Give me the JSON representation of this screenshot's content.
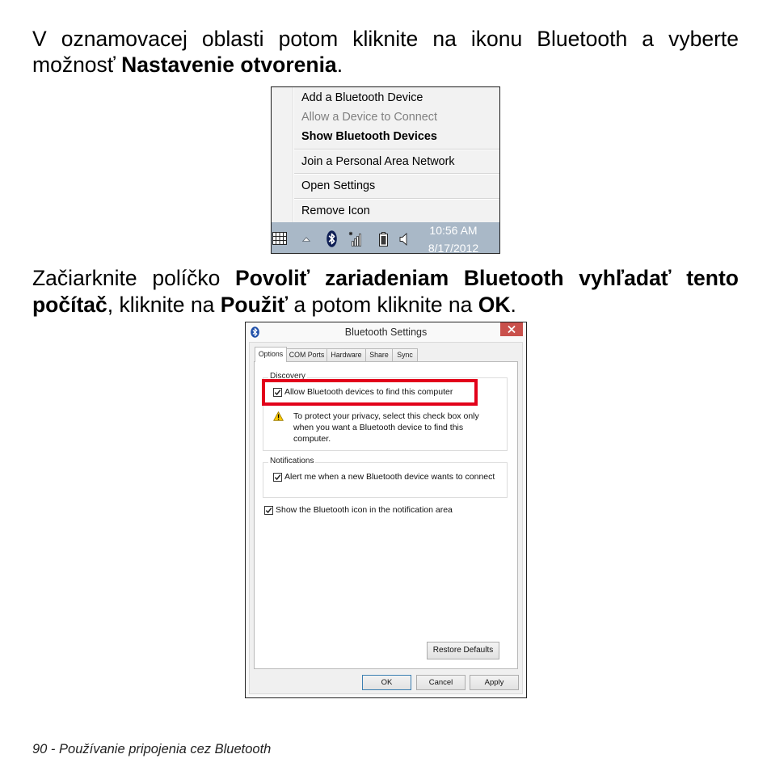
{
  "step1": {
    "line1": "V oznamovacej oblasti potom kliknite na ikonu Bluetooth a vyberte",
    "line2_text": "možnosť ",
    "line2_bold": "Nastavenie otvorenia",
    "line2_end": "."
  },
  "step2": {
    "line1_text": "Začiarknite políčko ",
    "line1_bold": "Povoliť zariadeniam Bluetooth vyhľadať tento",
    "line2_bold_a": "počítač",
    "line2_text_a": ", kliknite na ",
    "line2_bold_b": "Použiť",
    "line2_text_b": " a potom kliknite na ",
    "line2_bold_c": "OK",
    "line2_end": "."
  },
  "context_menu": {
    "items": [
      {
        "label": "Add a Bluetooth Device"
      },
      {
        "label": "Allow a Device to Connect",
        "disabled": true
      },
      {
        "label": "Show Bluetooth Devices",
        "bold": true
      },
      {
        "label": "Join a Personal Area Network"
      },
      {
        "label": "Open Settings"
      },
      {
        "label": "Remove Icon"
      }
    ]
  },
  "taskbar": {
    "tray_icons": [
      "keyboard-icon",
      "show-hidden-icons-icon",
      "bluetooth-icon",
      "network-signal-icon",
      "battery-icon",
      "speaker-icon"
    ],
    "time": "10:56 AM",
    "date": "8/17/2012"
  },
  "dialog": {
    "title": "Bluetooth Settings",
    "tabs": [
      {
        "label": "Options",
        "active": true
      },
      {
        "label": "COM Ports"
      },
      {
        "label": "Hardware"
      },
      {
        "label": "Share"
      },
      {
        "label": "Sync"
      }
    ],
    "discovery": {
      "group_label": "Discovery",
      "allow_label": "Allow Bluetooth devices to find this computer",
      "allow_checked": true,
      "warning_icon": "warning-icon",
      "warning_lines": [
        "To protect your privacy, select this check box only",
        "when you want a Bluetooth device to find this",
        "computer."
      ]
    },
    "notifications": {
      "group_label": "Notifications",
      "alert_label": "Alert me when a new Bluetooth device wants to connect",
      "alert_checked": true
    },
    "show_icon_label": "Show the Bluetooth icon in the notification area",
    "show_icon_checked": true,
    "restore_defaults": "Restore Defaults",
    "ok": "OK",
    "cancel": "Cancel",
    "apply": "Apply"
  },
  "footer": "90 - Používanie pripojenia cez Bluetooth",
  "colors": {
    "highlight_frame": "#e2001a",
    "taskbar": "#a9b8c7",
    "close_button": "#c9504b",
    "tray_bluetooth": "#0f1f55"
  }
}
